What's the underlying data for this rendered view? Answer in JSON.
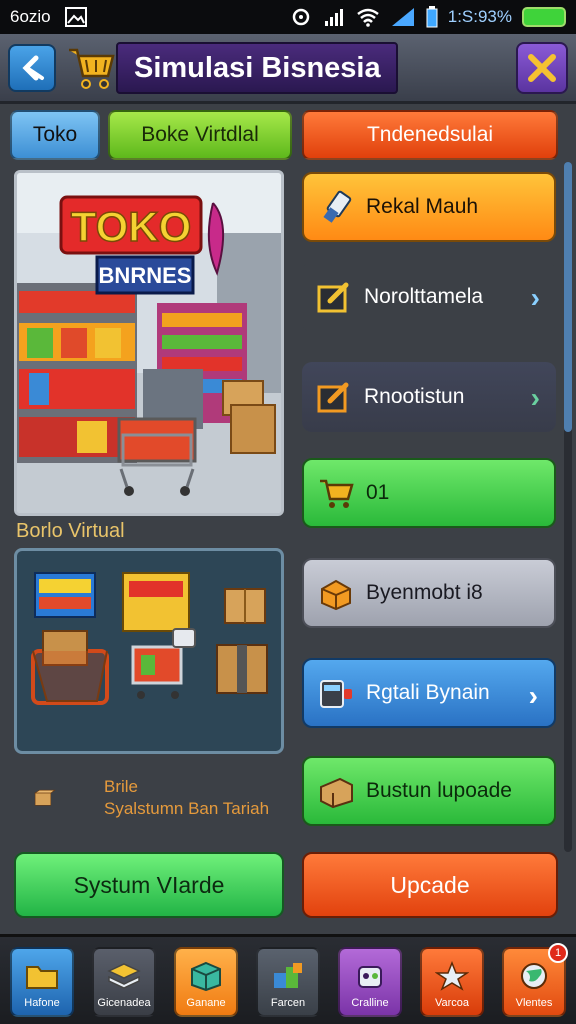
{
  "status_bar": {
    "carrier": "6ozio",
    "time": "1:S:93%"
  },
  "header": {
    "title": "Simulasi Bisnesia",
    "back_icon": "back-arrow-icon",
    "cart_icon": "shopping-cart-icon",
    "close_icon": "close-x-icon"
  },
  "top_tabs": [
    {
      "label": "Toko",
      "color": "#3d8fd4"
    },
    {
      "label": "Boke Virtdlal",
      "color": "#5eb81c"
    },
    {
      "label": "Tndenedsulai",
      "color": "#e0400c"
    }
  ],
  "store_image": {
    "sign_main": "TOKO",
    "sign_sub": "BNRNES"
  },
  "virtual_label": "Borlo Virtual",
  "crate_note": {
    "line1": "Brile",
    "line2": "Syalstumn Ban Tariah"
  },
  "menu": [
    {
      "label": "Rekal Mauh",
      "icon": "usb-stick-icon",
      "chevron": false
    },
    {
      "label": "Norolttamela",
      "icon": "edit-pencil-icon",
      "chevron": true
    },
    {
      "label": "Rnootistun",
      "icon": "edit-pencil-icon",
      "chevron": true
    },
    {
      "label": "01",
      "icon": "shopping-cart-icon",
      "chevron": false
    },
    {
      "label": "Byenmobt i8",
      "icon": "package-box-icon",
      "chevron": false
    },
    {
      "label": "Rgtali Bynain",
      "icon": "cash-register-icon",
      "chevron": true
    },
    {
      "label": "Bustun lupoade",
      "icon": "cardboard-box-icon",
      "chevron": false
    }
  ],
  "actions": {
    "system_label": "Systum VIarde",
    "upgrade_label": "Upcade"
  },
  "bottom_nav": [
    {
      "label": "Hafone",
      "icon": "folder-icon"
    },
    {
      "label": "Gicenadea",
      "icon": "layers-stack-icon"
    },
    {
      "label": "Ganane",
      "icon": "cube-icon"
    },
    {
      "label": "Farcen",
      "icon": "blocks-icon"
    },
    {
      "label": "Cralline",
      "icon": "robot-icon"
    },
    {
      "label": "Varcoa",
      "icon": "star-icon"
    },
    {
      "label": "Vlentes",
      "icon": "globe-icon",
      "badge": "1"
    }
  ]
}
